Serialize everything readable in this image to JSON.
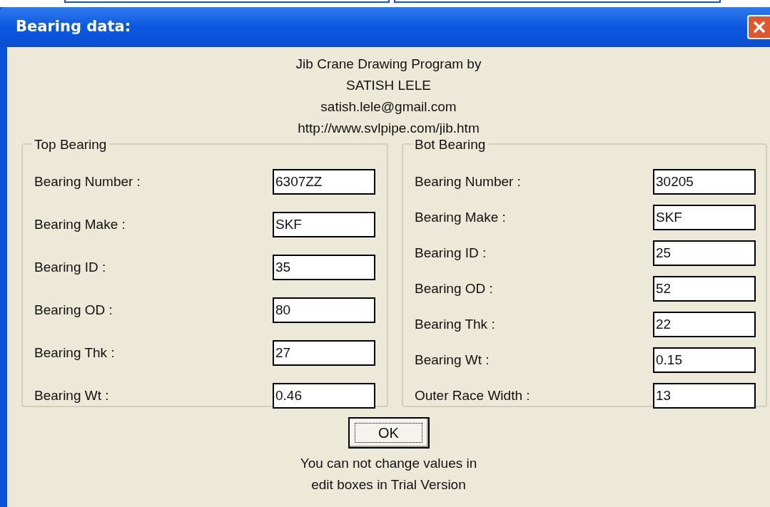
{
  "window": {
    "title": "Bearing data:"
  },
  "header": [
    "Jib Crane Drawing Program by",
    "SATISH LELE",
    "satish.lele@gmail.com",
    "http://www.svlpipe.com/jib.htm"
  ],
  "groups": [
    {
      "title": "Top Bearing",
      "fields": [
        {
          "label": "Bearing Number :",
          "value": "6307ZZ"
        },
        {
          "label": "Bearing Make :",
          "value": "SKF"
        },
        {
          "label": "Bearing ID :",
          "value": "35"
        },
        {
          "label": "Bearing OD :",
          "value": "80"
        },
        {
          "label": "Bearing Thk :",
          "value": "27"
        },
        {
          "label": "Bearing Wt :",
          "value": "0.46"
        }
      ]
    },
    {
      "title": "Bot Bearing",
      "fields": [
        {
          "label": "Bearing Number :",
          "value": "30205"
        },
        {
          "label": "Bearing Make :",
          "value": "SKF"
        },
        {
          "label": "Bearing ID :",
          "value": "25"
        },
        {
          "label": "Bearing OD :",
          "value": "52"
        },
        {
          "label": "Bearing Thk :",
          "value": "22"
        },
        {
          "label": "Bearing Wt :",
          "value": "0.15"
        },
        {
          "label": "Outer Race Width :",
          "value": "13"
        }
      ]
    }
  ],
  "ok_button": "OK",
  "note": [
    "You can not change values in",
    "edit boxes in Trial Version"
  ]
}
